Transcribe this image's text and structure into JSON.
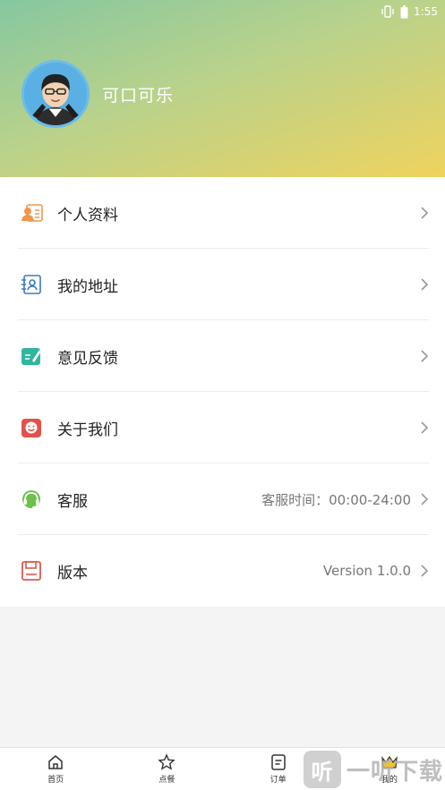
{
  "status_bar": {
    "time": "1:55"
  },
  "profile": {
    "username": "可口可乐"
  },
  "menu": {
    "items": [
      {
        "label": "个人资料",
        "value": "",
        "icon": "profile-card-icon"
      },
      {
        "label": "我的地址",
        "value": "",
        "icon": "address-book-icon"
      },
      {
        "label": "意见反馈",
        "value": "",
        "icon": "feedback-icon"
      },
      {
        "label": "关于我们",
        "value": "",
        "icon": "smile-icon"
      },
      {
        "label": "客服",
        "value": "客服时间：00:00-24:00",
        "icon": "headset-icon"
      },
      {
        "label": "版本",
        "value": "Version 1.0.0",
        "icon": "save-disk-icon"
      }
    ]
  },
  "tabbar": {
    "tabs": [
      {
        "label": "首页",
        "icon": "home-icon"
      },
      {
        "label": "点餐",
        "icon": "star-icon"
      },
      {
        "label": "订单",
        "icon": "order-list-icon"
      },
      {
        "label": "我的",
        "icon": "crown-icon",
        "active": true
      }
    ]
  },
  "watermark": {
    "badge": "听",
    "text": "一听下载"
  },
  "colors": {
    "header_gradient_start": "#86c7a0",
    "header_gradient_end": "#efd35e",
    "profile_icon": "#f0964c",
    "address_icon": "#3b7bbf",
    "feedback_icon": "#2fb6a0",
    "about_icon": "#e3514a",
    "headset_icon": "#6cc24a",
    "version_icon": "#e05a4e"
  }
}
